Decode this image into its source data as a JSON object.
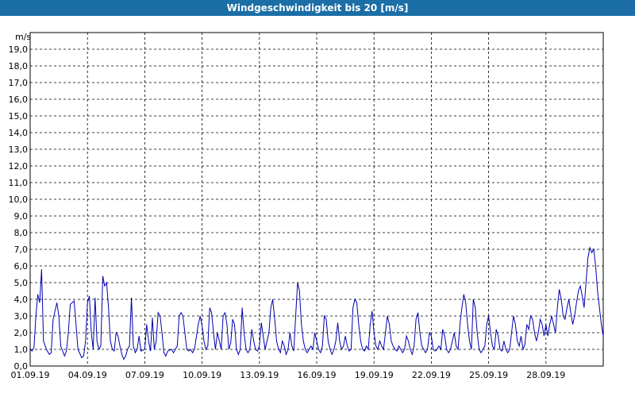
{
  "window": {
    "title": "Windgeschwindigkeit bis 20 [m/s]"
  },
  "chart_data": {
    "type": "line",
    "title": "Windgeschwindigkeit bis 20 [m/s]",
    "ylabel": "m/s",
    "xlabel": "",
    "ylim": [
      0,
      20
    ],
    "xlim_days": [
      0,
      30
    ],
    "grid": true,
    "line_color": "#0000b0",
    "x_ticks": [
      "01.09.19",
      "04.09.19",
      "07.09.19",
      "10.09.19",
      "13.09.19",
      "16.09.19",
      "19.09.19",
      "22.09.19",
      "25.09.19",
      "28.09.19"
    ],
    "y_ticks": [
      "0,0",
      "1,0",
      "2,0",
      "3,0",
      "4,0",
      "5,0",
      "6,0",
      "7,0",
      "8,0",
      "9,0",
      "10,0",
      "11,0",
      "12,0",
      "13,0",
      "14,0",
      "15,0",
      "16,0",
      "17,0",
      "18,0",
      "19,0"
    ],
    "series": [
      {
        "values": [
          [
            0.0,
            1.0
          ],
          [
            0.1,
            0.9
          ],
          [
            0.2,
            1.1
          ],
          [
            0.3,
            3.0
          ],
          [
            0.4,
            4.3
          ],
          [
            0.5,
            3.8
          ],
          [
            0.6,
            5.8
          ],
          [
            0.7,
            1.5
          ],
          [
            0.85,
            1.0
          ],
          [
            1.0,
            0.7
          ],
          [
            1.1,
            0.8
          ],
          [
            1.2,
            2.8
          ],
          [
            1.4,
            3.8
          ],
          [
            1.5,
            3.0
          ],
          [
            1.6,
            1.2
          ],
          [
            1.8,
            0.6
          ],
          [
            1.9,
            0.9
          ],
          [
            2.0,
            2.0
          ],
          [
            2.1,
            3.7
          ],
          [
            2.3,
            3.9
          ],
          [
            2.4,
            2.5
          ],
          [
            2.5,
            1.0
          ],
          [
            2.7,
            0.5
          ],
          [
            2.8,
            0.6
          ],
          [
            2.9,
            1.5
          ],
          [
            3.0,
            3.8
          ],
          [
            3.1,
            4.2
          ],
          [
            3.2,
            2.0
          ],
          [
            3.3,
            1.0
          ],
          [
            3.4,
            4.1
          ],
          [
            3.5,
            1.5
          ],
          [
            3.6,
            1.0
          ],
          [
            3.7,
            1.2
          ],
          [
            3.8,
            5.4
          ],
          [
            3.9,
            4.8
          ],
          [
            4.0,
            5.0
          ],
          [
            4.1,
            3.5
          ],
          [
            4.2,
            1.5
          ],
          [
            4.3,
            1.0
          ],
          [
            4.4,
            0.9
          ],
          [
            4.5,
            2.0
          ],
          [
            4.6,
            1.8
          ],
          [
            4.7,
            1.2
          ],
          [
            4.8,
            0.7
          ],
          [
            4.9,
            0.4
          ],
          [
            5.0,
            0.6
          ],
          [
            5.1,
            1.0
          ],
          [
            5.2,
            1.2
          ],
          [
            5.3,
            4.1
          ],
          [
            5.4,
            1.2
          ],
          [
            5.5,
            0.8
          ],
          [
            5.6,
            1.0
          ],
          [
            5.7,
            1.8
          ],
          [
            5.8,
            0.9
          ],
          [
            6.0,
            1.0
          ],
          [
            6.1,
            2.5
          ],
          [
            6.2,
            1.5
          ],
          [
            6.3,
            0.9
          ],
          [
            6.4,
            2.9
          ],
          [
            6.5,
            1.0
          ],
          [
            6.6,
            1.5
          ],
          [
            6.7,
            3.2
          ],
          [
            6.8,
            3.0
          ],
          [
            6.9,
            2.0
          ],
          [
            7.0,
            0.8
          ],
          [
            7.1,
            0.6
          ],
          [
            7.2,
            0.9
          ],
          [
            7.4,
            1.0
          ],
          [
            7.5,
            0.8
          ],
          [
            7.6,
            1.0
          ],
          [
            7.7,
            1.2
          ],
          [
            7.8,
            3.0
          ],
          [
            7.9,
            3.2
          ],
          [
            8.0,
            3.0
          ],
          [
            8.1,
            2.0
          ],
          [
            8.2,
            1.0
          ],
          [
            8.3,
            0.9
          ],
          [
            8.4,
            1.0
          ],
          [
            8.5,
            0.8
          ],
          [
            8.6,
            1.0
          ],
          [
            8.8,
            2.5
          ],
          [
            8.9,
            3.0
          ],
          [
            9.0,
            2.4
          ],
          [
            9.1,
            1.5
          ],
          [
            9.2,
            1.0
          ],
          [
            9.3,
            1.2
          ],
          [
            9.4,
            3.5
          ],
          [
            9.5,
            3.2
          ],
          [
            9.6,
            2.0
          ],
          [
            9.7,
            1.0
          ],
          [
            9.8,
            2.0
          ],
          [
            9.9,
            1.5
          ],
          [
            10.0,
            1.0
          ],
          [
            10.1,
            3.0
          ],
          [
            10.2,
            3.2
          ],
          [
            10.3,
            2.5
          ],
          [
            10.4,
            1.0
          ],
          [
            10.5,
            1.4
          ],
          [
            10.6,
            2.8
          ],
          [
            10.7,
            2.5
          ],
          [
            10.8,
            1.0
          ],
          [
            10.9,
            0.7
          ],
          [
            11.0,
            1.0
          ],
          [
            11.1,
            3.5
          ],
          [
            11.2,
            2.0
          ],
          [
            11.3,
            1.0
          ],
          [
            11.4,
            0.8
          ],
          [
            11.5,
            1.0
          ],
          [
            11.6,
            2.2
          ],
          [
            11.7,
            1.5
          ],
          [
            11.8,
            1.0
          ],
          [
            11.9,
            0.9
          ],
          [
            12.0,
            1.2
          ],
          [
            12.1,
            2.6
          ],
          [
            12.2,
            1.8
          ],
          [
            12.3,
            1.0
          ],
          [
            12.4,
            1.5
          ],
          [
            12.5,
            2.0
          ],
          [
            12.6,
            3.5
          ],
          [
            12.7,
            4.0
          ],
          [
            12.8,
            2.8
          ],
          [
            12.9,
            1.5
          ],
          [
            13.0,
            1.0
          ],
          [
            13.1,
            0.8
          ],
          [
            13.2,
            1.5
          ],
          [
            13.3,
            1.2
          ],
          [
            13.4,
            0.7
          ],
          [
            13.5,
            1.0
          ],
          [
            13.6,
            2.0
          ],
          [
            13.7,
            1.2
          ],
          [
            13.8,
            0.9
          ],
          [
            13.9,
            3.0
          ],
          [
            14.0,
            5.0
          ],
          [
            14.1,
            4.5
          ],
          [
            14.2,
            2.5
          ],
          [
            14.3,
            1.5
          ],
          [
            14.4,
            1.0
          ],
          [
            14.5,
            0.8
          ],
          [
            14.6,
            1.0
          ],
          [
            14.7,
            1.2
          ],
          [
            14.8,
            1.0
          ],
          [
            14.9,
            2.0
          ],
          [
            15.0,
            1.5
          ],
          [
            15.1,
            1.0
          ],
          [
            15.2,
            0.8
          ],
          [
            15.3,
            1.2
          ],
          [
            15.4,
            3.0
          ],
          [
            15.5,
            2.8
          ],
          [
            15.6,
            1.5
          ],
          [
            15.7,
            1.0
          ],
          [
            15.8,
            0.7
          ],
          [
            15.9,
            1.0
          ],
          [
            16.0,
            1.5
          ],
          [
            16.1,
            2.6
          ],
          [
            16.2,
            1.5
          ],
          [
            16.3,
            1.0
          ],
          [
            16.4,
            1.2
          ],
          [
            16.5,
            1.8
          ],
          [
            16.6,
            1.2
          ],
          [
            16.7,
            0.9
          ],
          [
            16.8,
            1.0
          ],
          [
            16.9,
            3.5
          ],
          [
            17.0,
            4.0
          ],
          [
            17.1,
            3.8
          ],
          [
            17.2,
            2.5
          ],
          [
            17.3,
            1.5
          ],
          [
            17.4,
            1.0
          ],
          [
            17.5,
            0.9
          ],
          [
            17.6,
            1.2
          ],
          [
            17.7,
            1.0
          ],
          [
            17.8,
            2.5
          ],
          [
            17.9,
            3.3
          ],
          [
            18.0,
            2.0
          ],
          [
            18.1,
            1.2
          ],
          [
            18.2,
            1.0
          ],
          [
            18.3,
            1.5
          ],
          [
            18.4,
            1.2
          ],
          [
            18.5,
            1.0
          ],
          [
            18.6,
            2.0
          ],
          [
            18.7,
            3.0
          ],
          [
            18.8,
            2.5
          ],
          [
            18.9,
            1.5
          ],
          [
            19.0,
            1.2
          ],
          [
            19.1,
            1.0
          ],
          [
            19.2,
            0.9
          ],
          [
            19.3,
            1.2
          ],
          [
            19.4,
            1.0
          ],
          [
            19.5,
            0.8
          ],
          [
            19.6,
            1.0
          ],
          [
            19.7,
            1.8
          ],
          [
            19.8,
            1.5
          ],
          [
            19.9,
            1.0
          ],
          [
            20.0,
            0.7
          ],
          [
            20.1,
            1.2
          ],
          [
            20.2,
            2.8
          ],
          [
            20.3,
            3.2
          ],
          [
            20.4,
            2.0
          ],
          [
            20.5,
            1.2
          ],
          [
            20.6,
            1.0
          ],
          [
            20.7,
            0.8
          ],
          [
            20.8,
            1.0
          ],
          [
            20.9,
            2.0
          ],
          [
            21.0,
            1.8
          ],
          [
            21.1,
            1.0
          ],
          [
            21.2,
            0.9
          ],
          [
            21.3,
            1.0
          ],
          [
            21.4,
            1.2
          ],
          [
            21.5,
            1.0
          ],
          [
            21.6,
            2.2
          ],
          [
            21.7,
            1.8
          ],
          [
            21.8,
            1.0
          ],
          [
            21.9,
            0.8
          ],
          [
            22.0,
            1.0
          ],
          [
            22.1,
            1.5
          ],
          [
            22.2,
            2.0
          ],
          [
            22.3,
            1.2
          ],
          [
            22.4,
            1.0
          ],
          [
            22.5,
            2.5
          ],
          [
            22.6,
            3.5
          ],
          [
            22.7,
            4.3
          ],
          [
            22.8,
            3.8
          ],
          [
            22.9,
            2.5
          ],
          [
            23.0,
            1.5
          ],
          [
            23.1,
            1.0
          ],
          [
            23.2,
            4.0
          ],
          [
            23.3,
            3.5
          ],
          [
            23.4,
            2.0
          ],
          [
            23.5,
            1.0
          ],
          [
            23.6,
            0.8
          ],
          [
            23.7,
            1.0
          ],
          [
            23.8,
            1.2
          ],
          [
            23.9,
            2.5
          ],
          [
            24.0,
            3.0
          ],
          [
            24.1,
            2.0
          ],
          [
            24.2,
            1.2
          ],
          [
            24.3,
            1.0
          ],
          [
            24.4,
            2.2
          ],
          [
            24.5,
            1.8
          ],
          [
            24.6,
            1.0
          ],
          [
            24.7,
            0.9
          ],
          [
            24.8,
            1.5
          ],
          [
            24.9,
            1.0
          ],
          [
            25.0,
            0.8
          ],
          [
            25.1,
            1.0
          ],
          [
            25.2,
            2.0
          ],
          [
            25.3,
            3.0
          ],
          [
            25.4,
            2.5
          ],
          [
            25.5,
            1.5
          ],
          [
            25.6,
            1.2
          ],
          [
            25.7,
            1.8
          ],
          [
            25.8,
            1.0
          ],
          [
            25.9,
            1.3
          ],
          [
            26.0,
            2.5
          ],
          [
            26.1,
            2.2
          ],
          [
            26.2,
            3.0
          ],
          [
            26.3,
            2.8
          ],
          [
            26.4,
            2.0
          ],
          [
            26.5,
            1.5
          ],
          [
            26.6,
            2.0
          ],
          [
            26.7,
            2.8
          ],
          [
            26.8,
            2.5
          ],
          [
            26.9,
            1.8
          ],
          [
            27.0,
            2.5
          ],
          [
            27.1,
            1.8
          ],
          [
            27.2,
            2.5
          ],
          [
            27.3,
            3.0
          ],
          [
            27.4,
            2.5
          ],
          [
            27.5,
            2.0
          ],
          [
            27.6,
            3.5
          ],
          [
            27.7,
            4.6
          ],
          [
            27.8,
            4.0
          ],
          [
            27.9,
            3.0
          ],
          [
            28.0,
            2.8
          ],
          [
            28.1,
            3.5
          ],
          [
            28.2,
            4.0
          ],
          [
            28.3,
            3.2
          ],
          [
            28.4,
            2.5
          ],
          [
            28.5,
            3.0
          ],
          [
            28.6,
            3.8
          ],
          [
            28.7,
            4.5
          ],
          [
            28.8,
            4.8
          ],
          [
            28.9,
            4.2
          ],
          [
            29.0,
            3.5
          ],
          [
            29.1,
            5.0
          ],
          [
            29.2,
            6.5
          ],
          [
            29.3,
            7.1
          ],
          [
            29.4,
            6.8
          ],
          [
            29.5,
            7.0
          ],
          [
            29.6,
            6.0
          ],
          [
            29.7,
            4.5
          ],
          [
            29.8,
            3.5
          ],
          [
            29.9,
            2.5
          ],
          [
            30.0,
            1.8
          ]
        ]
      }
    ]
  }
}
